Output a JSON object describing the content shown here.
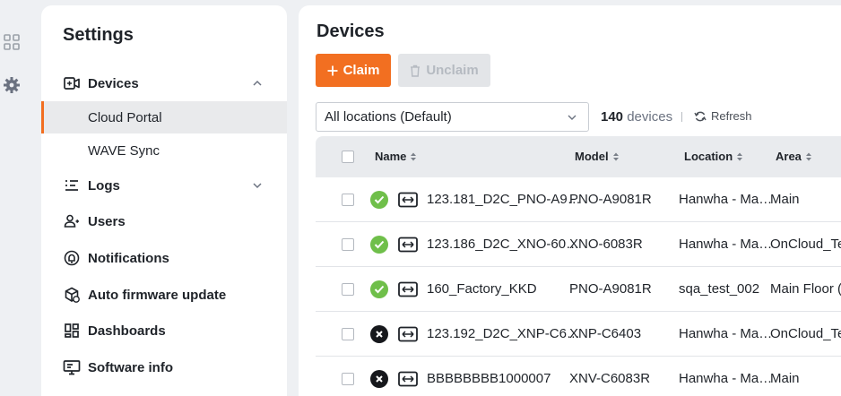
{
  "settings": {
    "title": "Settings",
    "nav": [
      {
        "label": "Devices",
        "icon": "camera-add-icon",
        "expanded": true
      },
      {
        "label": "Logs",
        "icon": "logs-icon",
        "expanded": false
      },
      {
        "label": "Users",
        "icon": "users-icon"
      },
      {
        "label": "Notifications",
        "icon": "notifications-icon"
      },
      {
        "label": "Auto firmware update",
        "icon": "firmware-update-icon"
      },
      {
        "label": "Dashboards",
        "icon": "dashboards-icon"
      },
      {
        "label": "Software info",
        "icon": "software-info-icon"
      }
    ],
    "devices_sub": [
      {
        "label": "Cloud Portal",
        "active": true
      },
      {
        "label": "WAVE Sync",
        "active": false
      }
    ]
  },
  "devices": {
    "title": "Devices",
    "claim_label": "Claim",
    "unclaim_label": "Unclaim",
    "location_select": "All locations (Default)",
    "count_number": "140",
    "count_unit": "devices",
    "refresh_label": "Refresh",
    "columns": [
      "Name",
      "Model",
      "Location",
      "Area"
    ],
    "rows": [
      {
        "status": "online",
        "name": "123.181_D2C_PNO-A9…",
        "model": "PNO-A9081R",
        "location": "Hanwha - Ma…",
        "area": "Main"
      },
      {
        "status": "online",
        "name": "123.186_D2C_XNO-60…",
        "model": "XNO-6083R",
        "location": "Hanwha - Ma…",
        "area": "OnCloud_Te"
      },
      {
        "status": "online",
        "name": "160_Factory_KKD",
        "model": "PNO-A9081R",
        "location": "sqa_test_002",
        "area": "Main Floor ("
      },
      {
        "status": "offline",
        "name": "123.192_D2C_XNP-C6…",
        "model": "XNP-C6403",
        "location": "Hanwha - Ma…",
        "area": "OnCloud_Te"
      },
      {
        "status": "offline",
        "name": "BBBBBBBB1000007",
        "model": "XNV-C6083R",
        "location": "Hanwha - Ma…",
        "area": "Main"
      }
    ]
  },
  "colors": {
    "accent": "#f26f21",
    "online": "#6fbf4a",
    "offline": "#16181c"
  }
}
